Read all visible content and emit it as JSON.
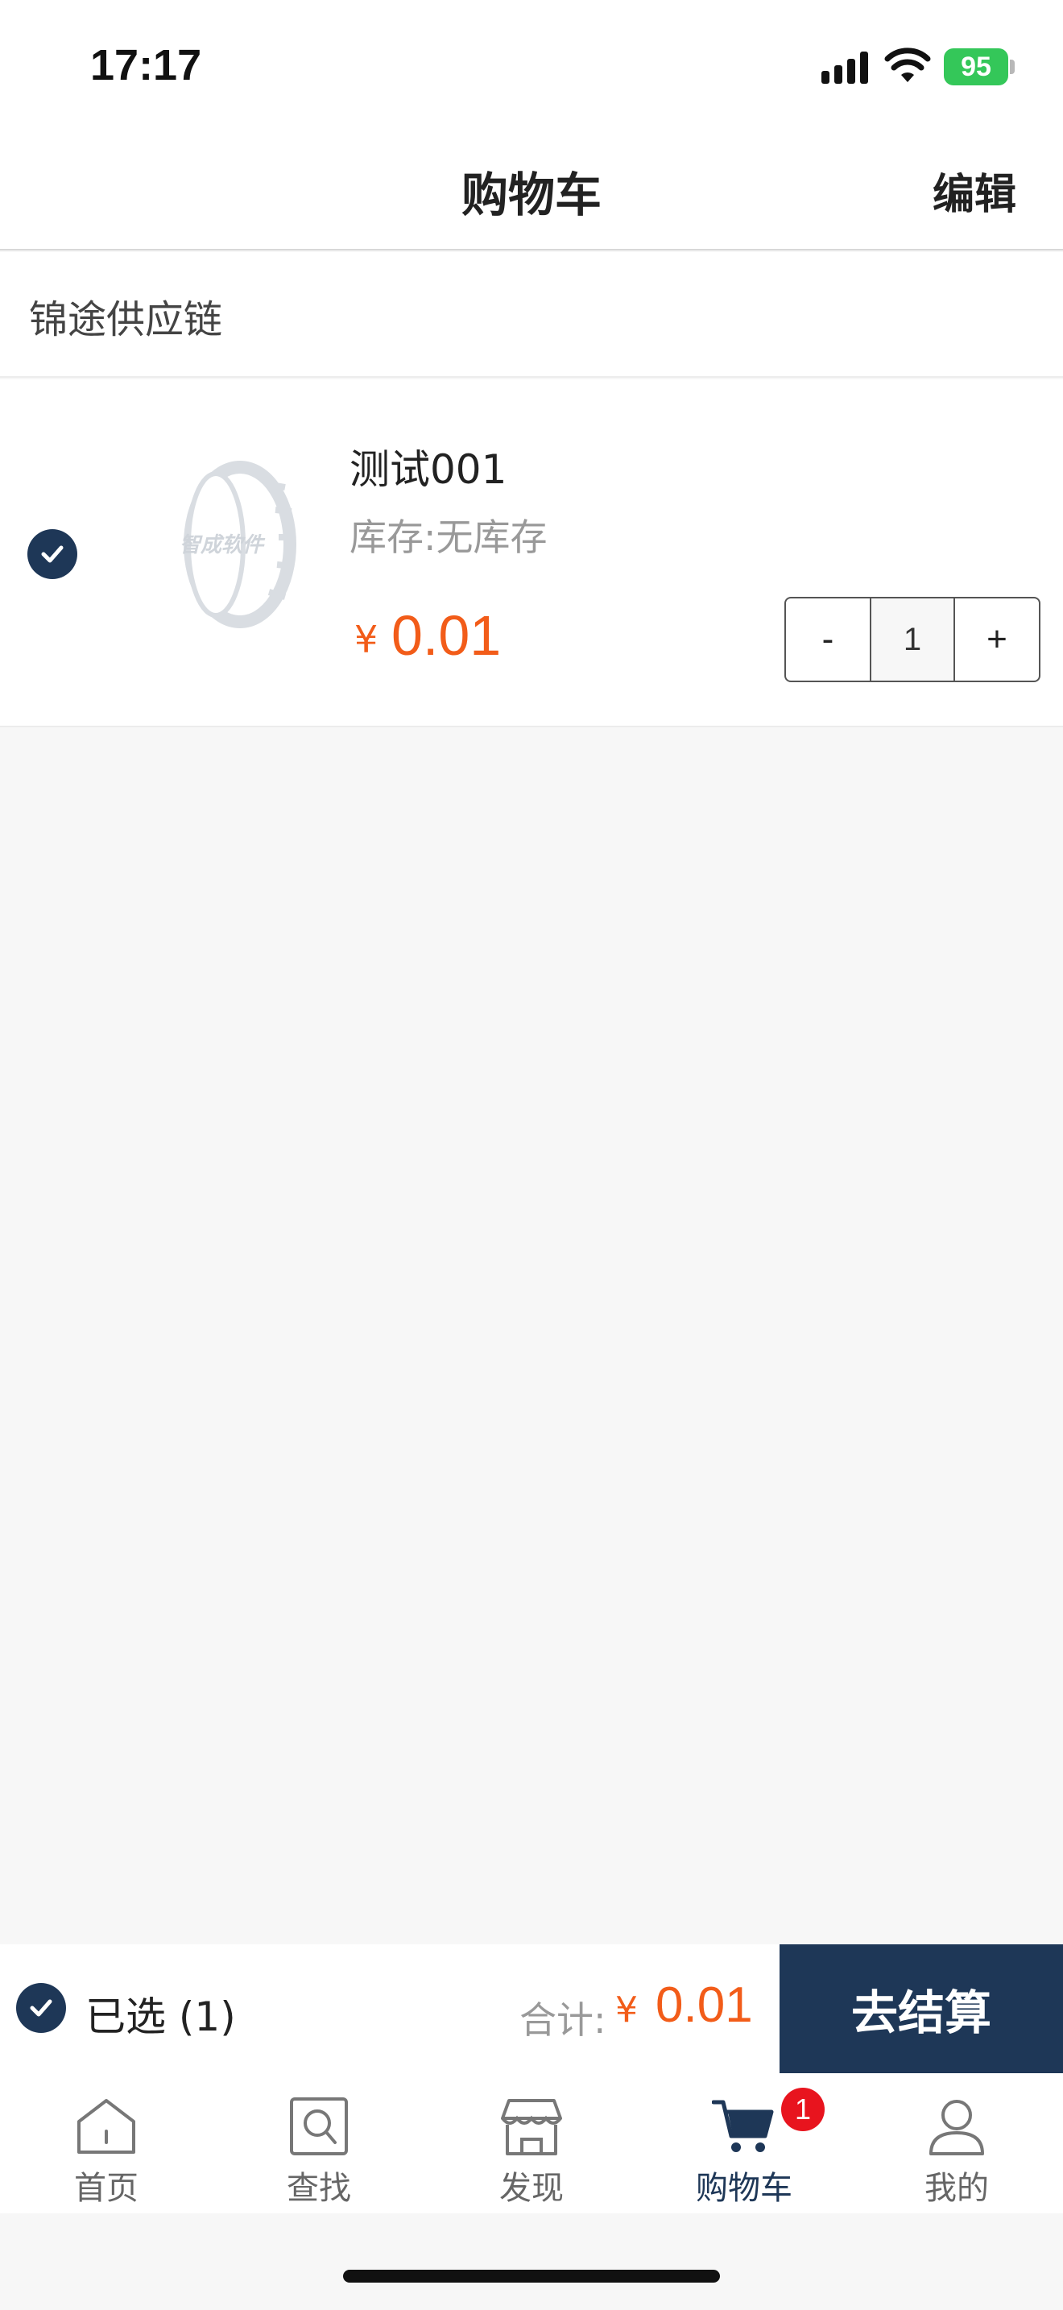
{
  "status_bar": {
    "time": "17:17",
    "battery": "95"
  },
  "nav": {
    "title": "购物车",
    "edit_label": "编辑"
  },
  "store": {
    "name": "锦途供应链"
  },
  "items": [
    {
      "name": "测试001",
      "stock": "库存:无库存",
      "image_watermark": "智成软件",
      "price_symbol": "¥",
      "price": "0.01",
      "quantity": "1",
      "minus_label": "-",
      "plus_label": "+",
      "checked": true
    }
  ],
  "checkout": {
    "selected_label": "已选 (1)",
    "total_label": "合计:",
    "total_symbol": "¥",
    "total_value": "0.01",
    "button_label": "去结算"
  },
  "tabs": [
    {
      "label": "首页",
      "icon": "home-icon"
    },
    {
      "label": "查找",
      "icon": "search-icon"
    },
    {
      "label": "发现",
      "icon": "store-icon"
    },
    {
      "label": "购物车",
      "icon": "cart-icon",
      "badge": "1",
      "active": true
    },
    {
      "label": "我的",
      "icon": "user-icon"
    }
  ],
  "colors": {
    "accent": "#1e3757",
    "price": "#f25c19",
    "badge": "#e8141e",
    "battery": "#34c759"
  }
}
